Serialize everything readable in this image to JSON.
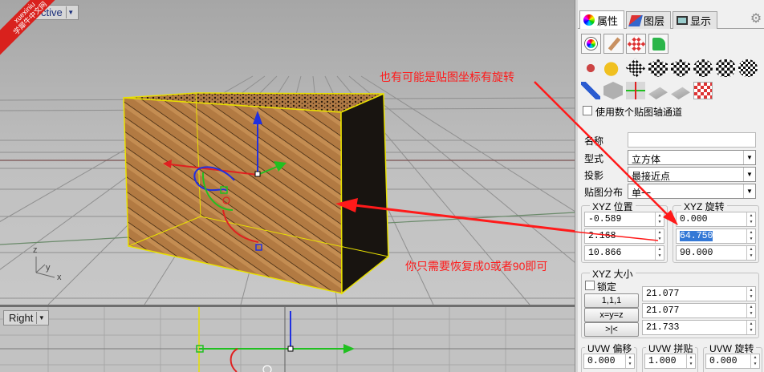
{
  "watermark": {
    "line1": "xuexiniu",
    "line2": "学犀牛中文网"
  },
  "viewport_top": {
    "label": "ctive",
    "axis_z": "z",
    "axis_y": "y",
    "axis_x": "x"
  },
  "viewport_bottom": {
    "label": "Right"
  },
  "annotations": {
    "mapping_rotation": "也有可能是贴图坐标有旋转",
    "restore_hint": "你只需要恢复成0或者90即可"
  },
  "panel": {
    "tabs": [
      {
        "label": "属性",
        "icon": "properties-icon"
      },
      {
        "label": "图层",
        "icon": "layers-icon"
      },
      {
        "label": "显示",
        "icon": "display-icon"
      }
    ],
    "multi_channel": {
      "label": "使用数个贴图轴通道",
      "checked": false
    },
    "name": {
      "label": "名称",
      "value": ""
    },
    "type": {
      "label": "型式",
      "value": "立方体"
    },
    "projection": {
      "label": "投影",
      "value": "最接近点"
    },
    "distribution": {
      "label": "贴图分布",
      "value": "单一"
    },
    "xyz_position": {
      "title": "XYZ 位置",
      "x": "-0.589",
      "y": "2.168",
      "z": "10.866"
    },
    "xyz_rotation": {
      "title": "XYZ 旋转",
      "x": "0.000",
      "y": "64.750",
      "z": "90.000"
    },
    "xyz_size": {
      "title": "XYZ 大小",
      "lock": {
        "label": "锁定",
        "checked": false
      },
      "btn_111": "1,1,1",
      "btn_xyz": "x=y=z",
      "btn_flip": ">|<",
      "x": "21.077",
      "y": "21.077",
      "z": "21.733"
    },
    "uvw_offset": {
      "title": "UVW 偏移",
      "value": "0.000"
    },
    "uvw_tile": {
      "title": "UVW 拼贴",
      "value": "1.000"
    },
    "uvw_rotate": {
      "title": "UVW 旋转",
      "value": "0.000"
    }
  },
  "colors": {
    "annotation": "#ff1a1a",
    "selection": "#3378d6",
    "wood": "#b27a42",
    "gumball_x": "#e02020",
    "gumball_y": "#20c020",
    "gumball_z": "#2030e0"
  }
}
